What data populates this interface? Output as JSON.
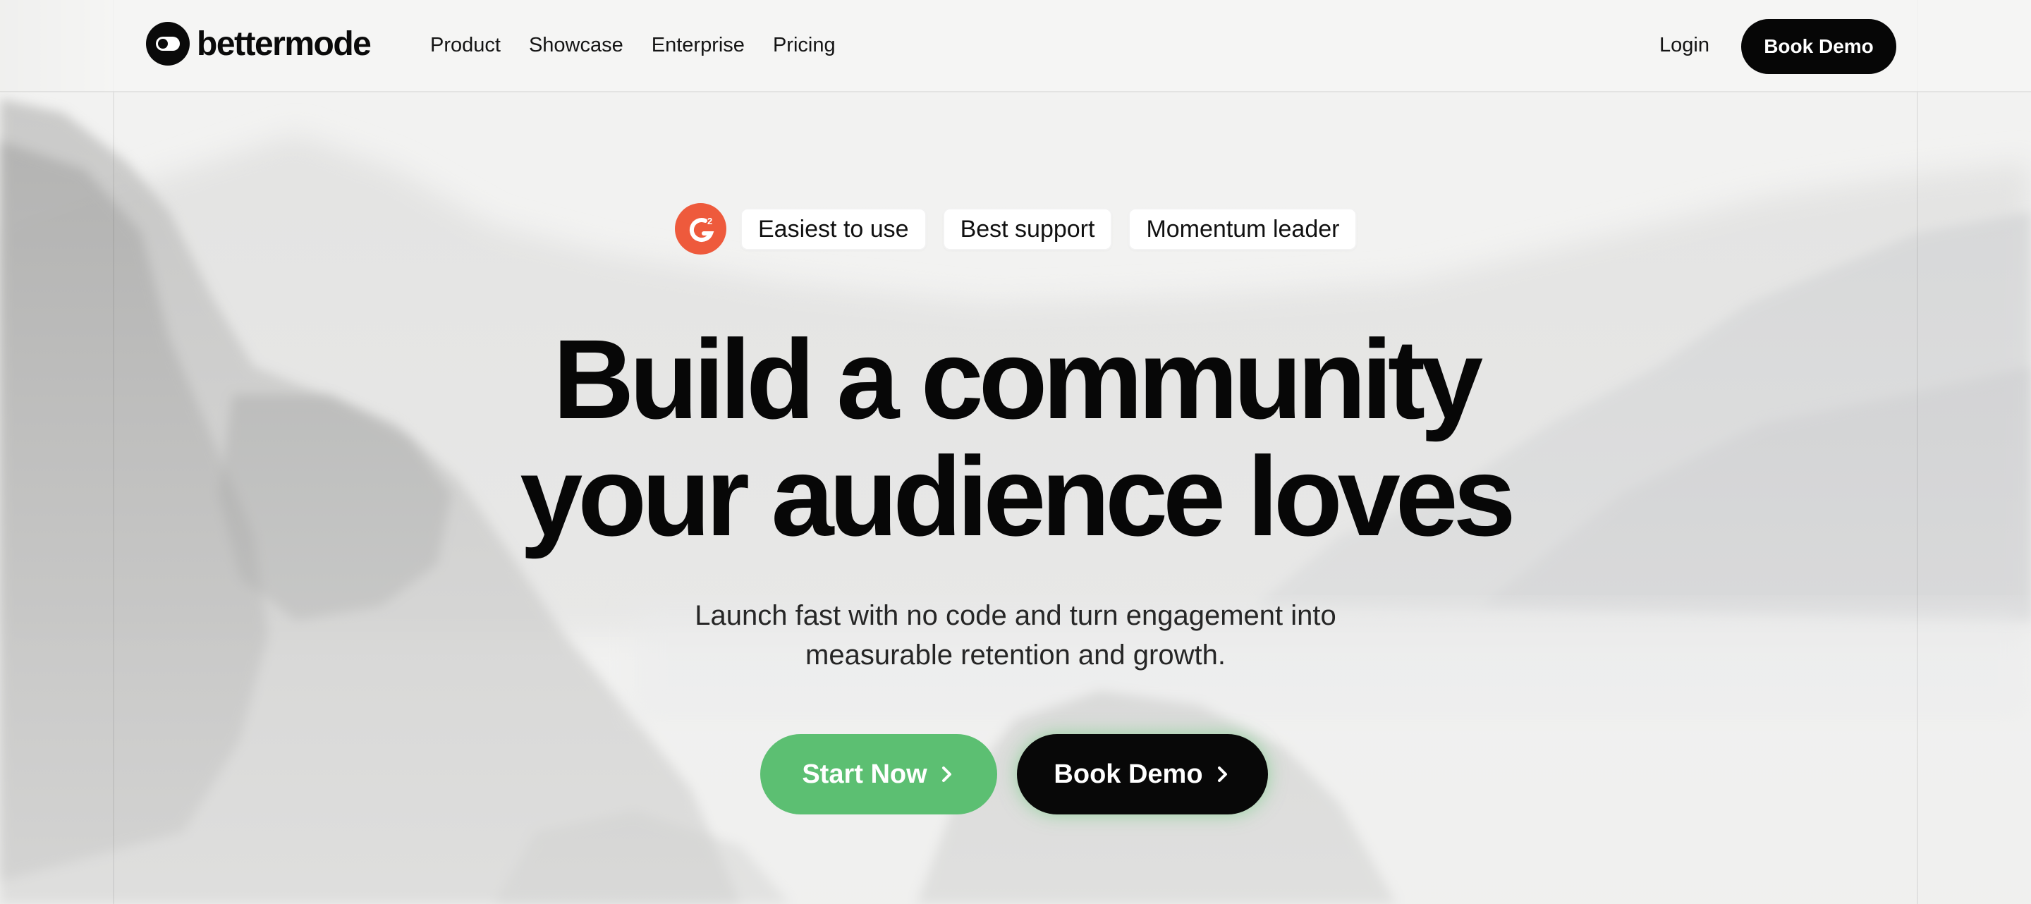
{
  "brand": {
    "name": "bettermode",
    "logo_icon": "bettermode-logo-icon"
  },
  "nav": {
    "links": [
      "Product",
      "Showcase",
      "Enterprise",
      "Pricing"
    ],
    "login": "Login",
    "book_demo": "Book Demo"
  },
  "badges": {
    "g2_icon": "g2-logo-icon",
    "items": [
      "Easiest to use",
      "Best support",
      "Momentum leader"
    ]
  },
  "hero": {
    "title_line1": "Build a community",
    "title_line2": "your audience loves",
    "subtitle_line1": "Launch fast with no code and turn engagement into",
    "subtitle_line2": "measurable retention and growth.",
    "start_now": "Start Now",
    "book_demo": "Book Demo"
  },
  "colors": {
    "accent_green": "#5cbf72",
    "dark": "#080808",
    "g2_red": "#ee5a3c",
    "background": "#f2f2f1"
  }
}
